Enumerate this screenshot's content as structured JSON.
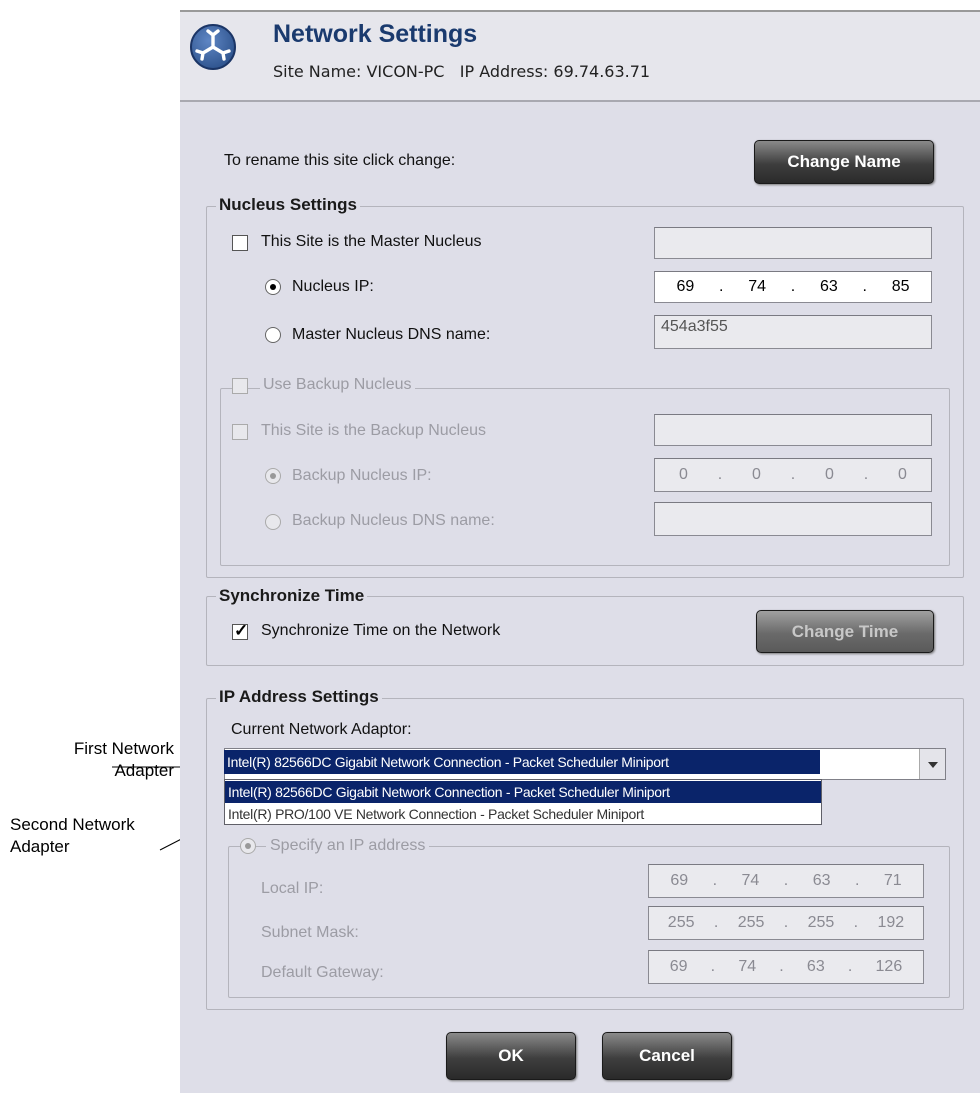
{
  "header": {
    "title": "Network Settings",
    "subtitle": "Site Name: VICON-PC   IP Address: 69.74.63.71"
  },
  "rename": {
    "label": "To rename this site click change:",
    "button": "Change Name"
  },
  "nucleus": {
    "title": "Nucleus Settings",
    "master_label": "This Site is the Master Nucleus",
    "nucleus_ip_label": "Nucleus IP:",
    "nucleus_ip": [
      "69",
      "74",
      "63",
      "85"
    ],
    "dns_label": "Master Nucleus DNS name:",
    "dns_value": "454a3f55",
    "backup": {
      "title": "Use Backup Nucleus",
      "backup_site_label": "This Site is the Backup Nucleus",
      "backup_ip_label": "Backup Nucleus IP:",
      "backup_ip": [
        "0",
        "0",
        "0",
        "0"
      ],
      "backup_dns_label": "Backup Nucleus DNS name:"
    }
  },
  "sync": {
    "title": "Synchronize Time",
    "checkbox_label": "Synchronize Time on the Network",
    "button": "Change Time"
  },
  "ip_settings": {
    "title": "IP Address Settings",
    "adaptor_label": "Current Network Adaptor:",
    "selected_adaptor": "Intel(R) 82566DC Gigabit Network Connection - Packet Scheduler Miniport",
    "options": [
      "Intel(R) 82566DC Gigabit Network Connection - Packet Scheduler Miniport",
      "Intel(R) PRO/100 VE Network Connection - Packet Scheduler Miniport"
    ],
    "specify_label": "Specify an IP address",
    "local_ip_label": "Local IP:",
    "local_ip": [
      "69",
      "74",
      "63",
      "71"
    ],
    "subnet_label": "Subnet Mask:",
    "subnet": [
      "255",
      "255",
      "255",
      "192"
    ],
    "gateway_label": "Default Gateway:",
    "gateway": [
      "69",
      "74",
      "63",
      "126"
    ]
  },
  "footer": {
    "ok": "OK",
    "cancel": "Cancel"
  },
  "annotations": {
    "first_line1": "First Network",
    "first_line2": "Adapter",
    "second_line1": "Second Network",
    "second_line2": "Adapter"
  }
}
